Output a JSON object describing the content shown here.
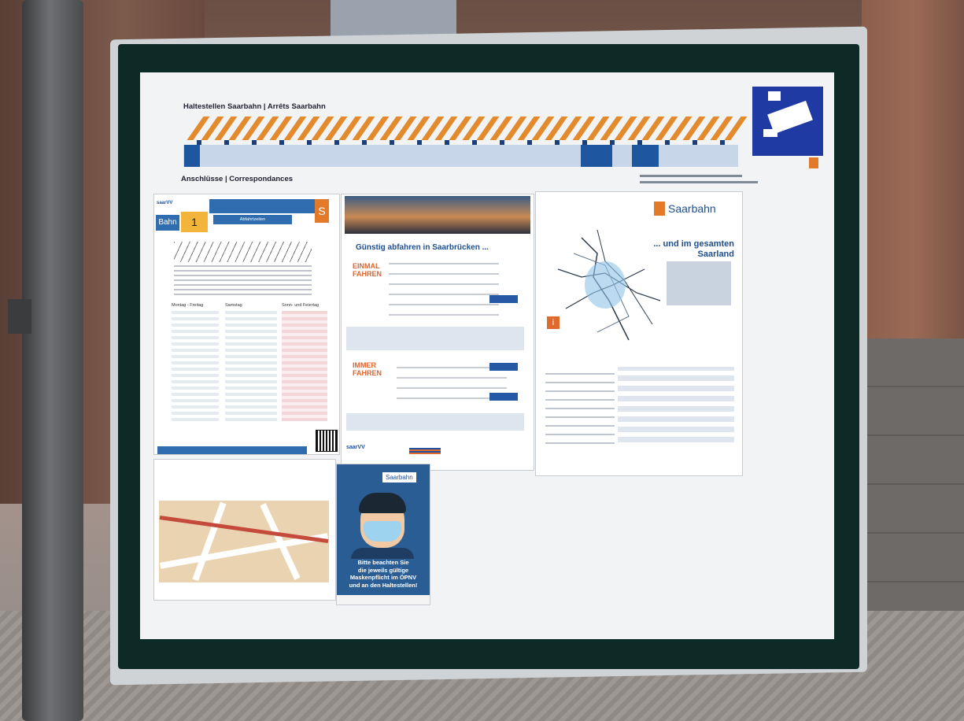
{
  "strip": {
    "title": "Haltestellen Saarbahn | Arrêts Saarbahn",
    "subtitle": "Anschlüsse | Correspondances"
  },
  "timetable": {
    "logo": "saarVV",
    "bahn": "Bahn",
    "line": "1",
    "title": "Abfahrtzeiten",
    "s_logo": "S",
    "col1": "Montag - Freitag",
    "col2": "Samstag",
    "col3": "Sonn- und Feiertag"
  },
  "fares": {
    "headline": "Günstig abfahren in Saarbrücken ...",
    "section1": "EINMAL\nFAHREN",
    "section2": "IMMER\nFAHREN"
  },
  "network": {
    "brand": "Saarbahn",
    "subline": "... und im gesamten\nSaarland"
  },
  "poster": {
    "brand": "Saarbahn",
    "text": "Bitte beachten Sie\ndie jeweils gültige\nMaskenpflicht im ÖPNV\nund an den Haltestellen!"
  },
  "colors": {
    "accent_orange": "#e38a2c",
    "accent_blue": "#1f56a0"
  }
}
